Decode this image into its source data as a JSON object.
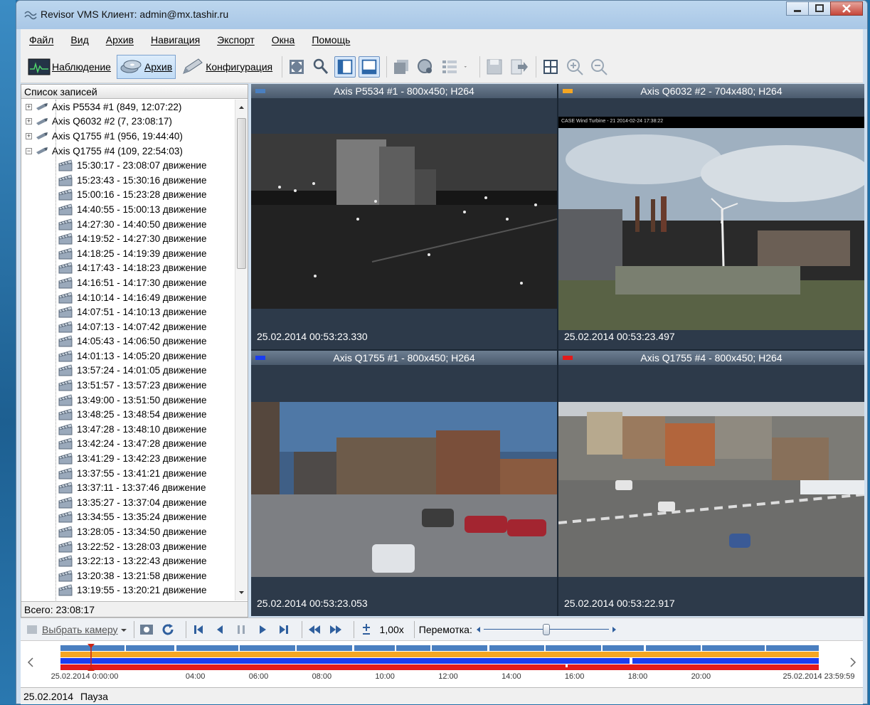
{
  "window": {
    "title": "Revisor VMS Клиент: admin@mx.tashir.ru"
  },
  "menu": [
    "Файл",
    "Вид",
    "Архив",
    "Навигация",
    "Экспорт",
    "Окна",
    "Помощь"
  ],
  "modes": {
    "observe": "Наблюдение",
    "archive": "Архив",
    "config": "Конфигурация"
  },
  "records_panel": {
    "header": "Список записей",
    "cameras": [
      "Axis P5534 #1 (849, 12:07:22)",
      "Axis Q6032 #2 (7, 23:08:17)",
      "Axis Q1755 #1 (956, 19:44:40)",
      "Axis Q1755 #4 (109, 22:54:03)"
    ],
    "records": [
      "15:30:17 - 23:08:07 движение",
      "15:23:43 - 15:30:16 движение",
      "15:00:16 - 15:23:28 движение",
      "14:40:55 - 15:00:13 движение",
      "14:27:30 - 14:40:50 движение",
      "14:19:52 - 14:27:30 движение",
      "14:18:25 - 14:19:39 движение",
      "14:17:43 - 14:18:23 движение",
      "14:16:51 - 14:17:30 движение",
      "14:10:14 - 14:16:49 движение",
      "14:07:51 - 14:10:13 движение",
      "14:07:13 - 14:07:42 движение",
      "14:05:43 - 14:06:50 движение",
      "14:01:13 - 14:05:20 движение",
      "13:57:24 - 14:01:05 движение",
      "13:51:57 - 13:57:23 движение",
      "13:49:00 - 13:51:50 движение",
      "13:48:25 - 13:48:54 движение",
      "13:47:28 - 13:48:10 движение",
      "13:42:24 - 13:47:28 движение",
      "13:41:29 - 13:42:23 движение",
      "13:37:55 - 13:41:21 движение",
      "13:37:11 - 13:37:46 движение",
      "13:35:27 - 13:37:04 движение",
      "13:34:55 - 13:35:24 движение",
      "13:28:05 - 13:34:50 движение",
      "13:22:52 - 13:28:03 движение",
      "13:22:13 - 13:22:43 движение",
      "13:20:38 - 13:21:58 движение",
      "13:19:55 - 13:20:21 движение"
    ],
    "total": "Всего: 23:08:17"
  },
  "views": [
    {
      "title": "Axis P5534 #1 - 800x450; H264",
      "timestamp": "25.02.2014 00:53:23.330",
      "color": "#4a7fc0"
    },
    {
      "title": "Axis Q6032 #2 - 704x480; H264",
      "timestamp": "25.02.2014 00:53:23.497",
      "color": "#f5a623",
      "overlay": "CASE Wind Turbine - 21 2014-02-24 17:38:22"
    },
    {
      "title": "Axis Q1755 #1 - 800x450; H264",
      "timestamp": "25.02.2014 00:53:23.053",
      "color": "#1a3df0"
    },
    {
      "title": "Axis Q1755 #4 - 800x450; H264",
      "timestamp": "25.02.2014 00:53:22.917",
      "color": "#e21b1b"
    }
  ],
  "controls": {
    "select_camera": "Выбрать камеру",
    "speed": "1,00x",
    "rewind_label": "Перемотка:",
    "rewind_position": 0.5
  },
  "timeline": {
    "start_label": "25.02.2014 0:00:00",
    "end_label": "25.02.2014 23:59:59",
    "ticks": [
      "04:00",
      "06:00",
      "08:00",
      "10:00",
      "12:00",
      "14:00",
      "16:00",
      "18:00",
      "20:00"
    ]
  },
  "status": {
    "date": "25.02.2014",
    "state": "Пауза"
  }
}
